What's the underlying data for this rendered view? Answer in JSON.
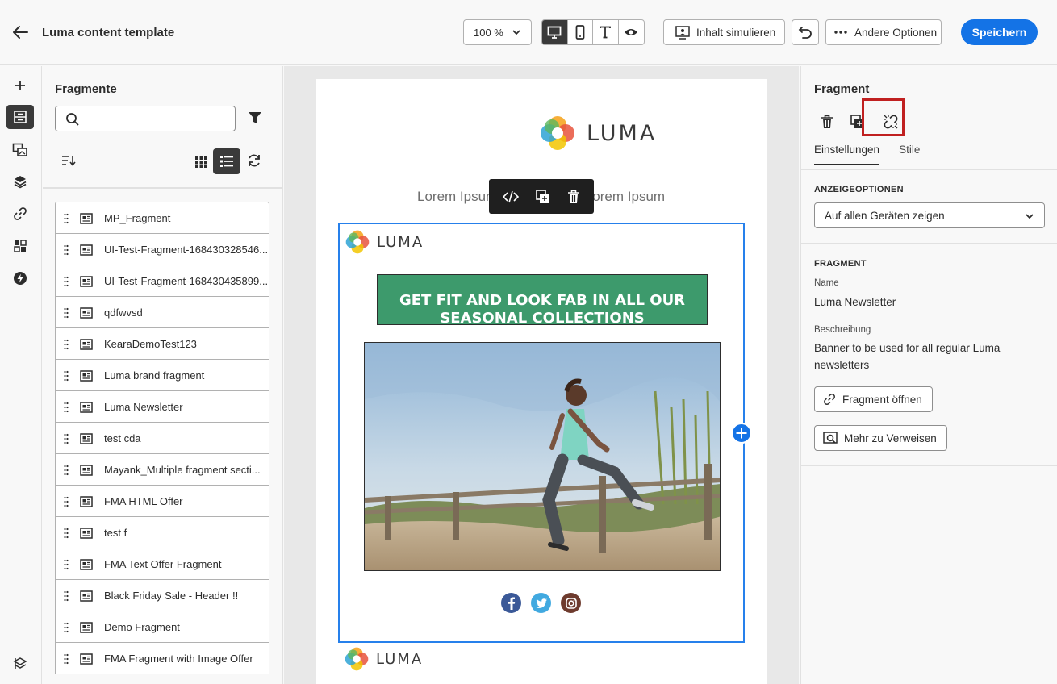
{
  "header": {
    "title": "Luma content template",
    "zoom_value": "100 %",
    "simulate_label": "Inhalt simulieren",
    "options_label": "Andere Optionen",
    "save_label": "Speichern"
  },
  "fragments_panel": {
    "title": "Fragmente",
    "search_value": "",
    "items": [
      {
        "name": "MP_Fragment"
      },
      {
        "name": "UI-Test-Fragment-168430328546..."
      },
      {
        "name": "UI-Test-Fragment-168430435899..."
      },
      {
        "name": "qdfwvsd"
      },
      {
        "name": "KearaDemoTest123"
      },
      {
        "name": "Luma brand fragment"
      },
      {
        "name": "Luma Newsletter"
      },
      {
        "name": "test cda"
      },
      {
        "name": "Mayank_Multiple fragment secti..."
      },
      {
        "name": "FMA HTML Offer"
      },
      {
        "name": "test f"
      },
      {
        "name": "FMA Text Offer Fragment"
      },
      {
        "name": "Black Friday Sale - Header !!"
      },
      {
        "name": "Demo Fragment"
      },
      {
        "name": "FMA Fragment with Image Offer"
      }
    ]
  },
  "canvas": {
    "logo_text": "LUMA",
    "lorem_text": "Lorem Ipsum Lorem Ipsum Lorem Ipsum",
    "banner_text": "GET FIT AND LOOK FAB IN ALL OUR SEASONAL COLLECTIONS",
    "brand_colors": {
      "banner": "#3d9a6c",
      "selection": "#2680eb",
      "accent": "#1473e6"
    }
  },
  "right_panel": {
    "title": "Fragment",
    "tabs": [
      {
        "label": "Einstellungen"
      },
      {
        "label": "Stile"
      }
    ],
    "display_options_heading": "ANZEIGEOPTIONEN",
    "display_options_value": "Auf allen Geräten zeigen",
    "fragment_heading": "FRAGMENT",
    "name_label": "Name",
    "name_value": "Luma Newsletter",
    "description_label": "Beschreibung",
    "description_value": "Banner to be used for all regular Luma newsletters",
    "open_button": "Fragment öffnen",
    "references_button": "Mehr zu Verweisen"
  }
}
